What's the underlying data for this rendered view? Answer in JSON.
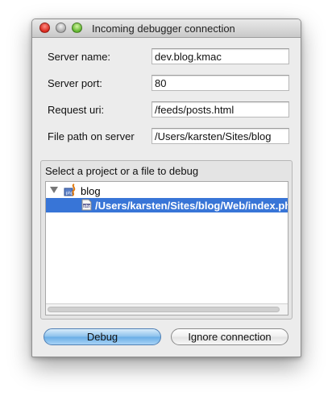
{
  "window": {
    "title": "Incoming debugger connection"
  },
  "form": {
    "server_name": {
      "label": "Server name:",
      "value": "dev.blog.kmac"
    },
    "server_port": {
      "label": "Server port:",
      "value": "80"
    },
    "request_uri": {
      "label": "Request uri:",
      "value": "/feeds/posts.html"
    },
    "file_path": {
      "label": "File path on server",
      "value": "/Users/karsten/Sites/blog"
    }
  },
  "selection": {
    "label": "Select a project or a file to debug",
    "tree": {
      "project": {
        "name": "blog",
        "icon": "php-project-icon"
      },
      "file": {
        "path": "/Users/karsten/Sites/blog/Web/index.ph",
        "icon": "php-file-icon"
      }
    }
  },
  "buttons": {
    "debug": "Debug",
    "ignore": "Ignore connection"
  },
  "colors": {
    "selection": "#3875d7",
    "default_button": "#8cc2ec"
  }
}
